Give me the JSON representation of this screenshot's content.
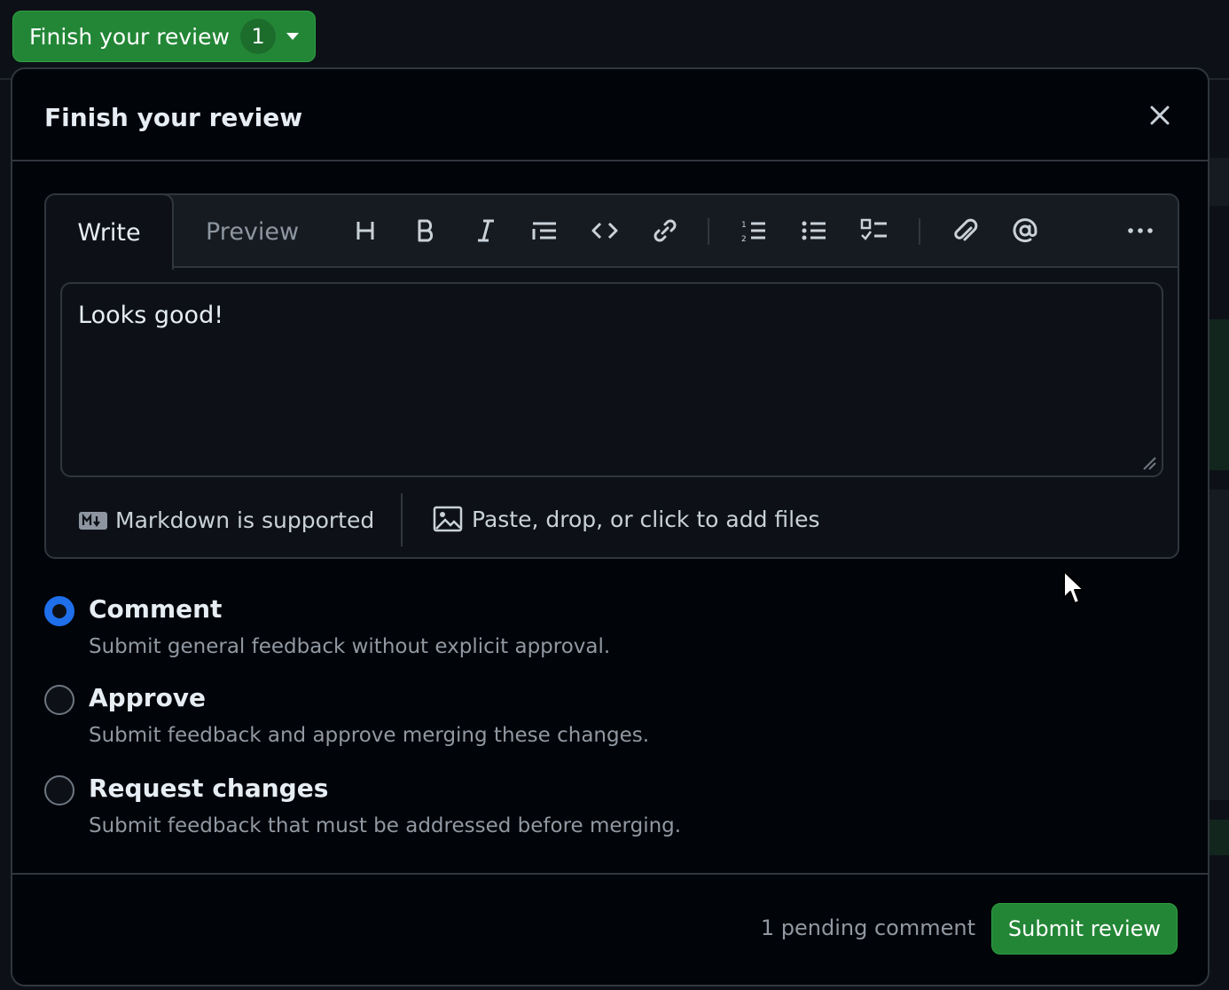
{
  "trigger": {
    "label": "Finish your review",
    "count": "1"
  },
  "dialog": {
    "title": "Finish your review",
    "close_icon": "x-icon"
  },
  "editor": {
    "tabs": {
      "write": "Write",
      "preview": "Preview"
    },
    "toolbar_icons": [
      "heading-icon",
      "bold-icon",
      "italic-icon",
      "quote-icon",
      "code-icon",
      "link-icon",
      "ordered-list-icon",
      "unordered-list-icon",
      "task-list-icon",
      "paperclip-icon",
      "mention-icon",
      "more-icon"
    ],
    "text": "Looks good!",
    "markdown_note": "Markdown is supported",
    "attach_note": "Paste, drop, or click to add files"
  },
  "options": [
    {
      "title": "Comment",
      "desc": "Submit general feedback without explicit approval.",
      "checked": true
    },
    {
      "title": "Approve",
      "desc": "Submit feedback and approve merging these changes.",
      "checked": false
    },
    {
      "title": "Request changes",
      "desc": "Submit feedback that must be addressed before merging.",
      "checked": false
    }
  ],
  "footer": {
    "pending": "1 pending comment",
    "submit": "Submit review"
  },
  "colors": {
    "accent_green": "#238636",
    "accent_blue": "#1f6feb",
    "background": "#010409"
  }
}
